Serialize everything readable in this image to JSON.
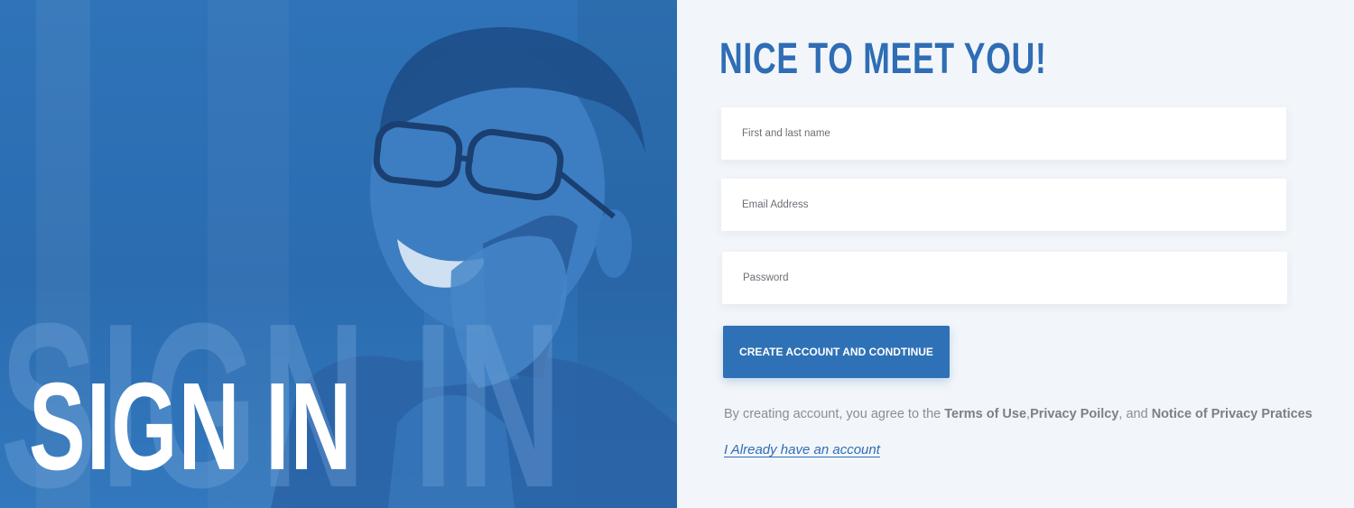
{
  "hero": {
    "big_letters": "SIGN IN",
    "heading": "SIGN IN"
  },
  "form": {
    "title": "NICE TO MEET YOU!",
    "name_placeholder": "First and last name",
    "email_placeholder": "Email Address",
    "password_placeholder": "Password",
    "submit_label": "CREATE ACCOUNT AND CONDTINUE",
    "terms": {
      "prefix": "By creating account, you agree to the ",
      "terms_of_use": "Terms of Use",
      "sep1": ",",
      "privacy_policy": "Privacy Poilcy",
      "sep2": ", and ",
      "notice": "Notice of Privacy Pratices"
    },
    "login_link": "I Already have an account"
  },
  "colors": {
    "brand_blue": "#2f71b6",
    "panel_bg": "#f2f6fa"
  }
}
